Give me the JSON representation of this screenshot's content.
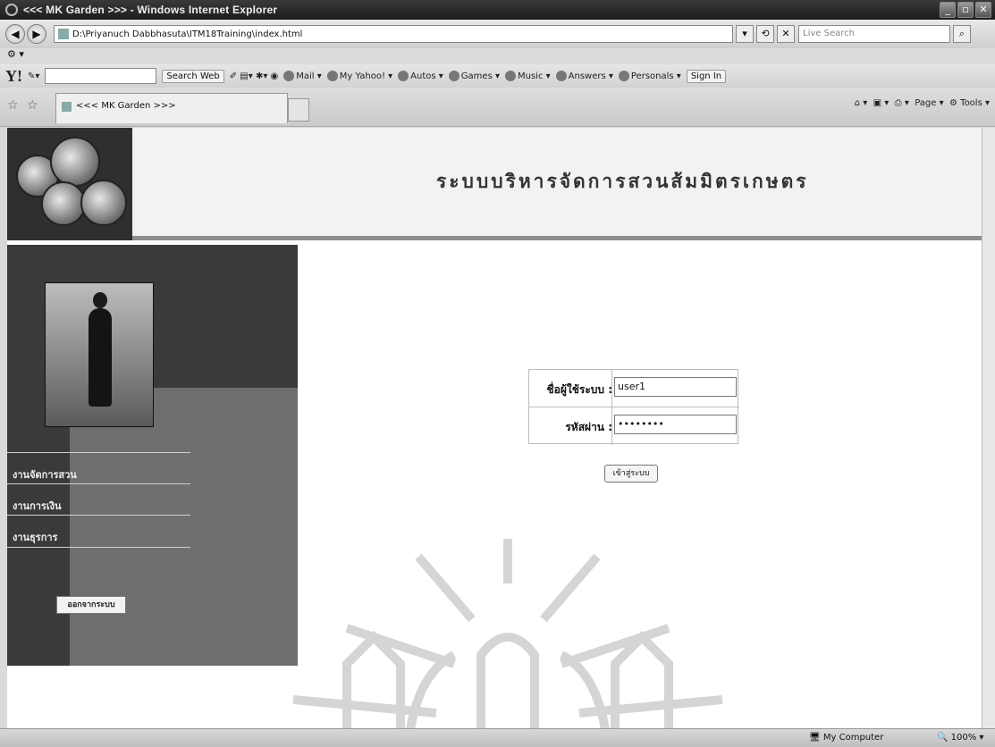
{
  "window": {
    "title": "<<< MK Garden >>> - Windows Internet Explorer"
  },
  "address_bar": {
    "url": "D:\\Priyanuch Dabbhasuta\\ITM18Training\\index.html",
    "search_placeholder": "Live Search"
  },
  "yahoo_toolbar": {
    "search_button": "Search Web",
    "links": [
      "Mail",
      "My Yahoo!",
      "Autos",
      "Games",
      "Music",
      "Answers",
      "Personals"
    ],
    "sign_in": "Sign In"
  },
  "tab": {
    "label": "<<< MK Garden >>>"
  },
  "command_bar": {
    "page": "Page",
    "tools": "Tools"
  },
  "page": {
    "site_title": "ระบบบริหารจัดการสวนส้มมิตรเกษตร",
    "menu": [
      "งานจัดการสวน",
      "งานการเงิน",
      "งานธุรการ"
    ],
    "logout_label": "ออกจากระบบ",
    "login": {
      "username_label": "ชื่อผู้ใช้ระบบ :",
      "username_value": "user1",
      "password_label": "รหัสผ่าน :",
      "password_value": "••••••••",
      "submit_label": "เข้าสู่ระบบ"
    }
  },
  "status_bar": {
    "zone": "My Computer",
    "zoom": "100%"
  }
}
